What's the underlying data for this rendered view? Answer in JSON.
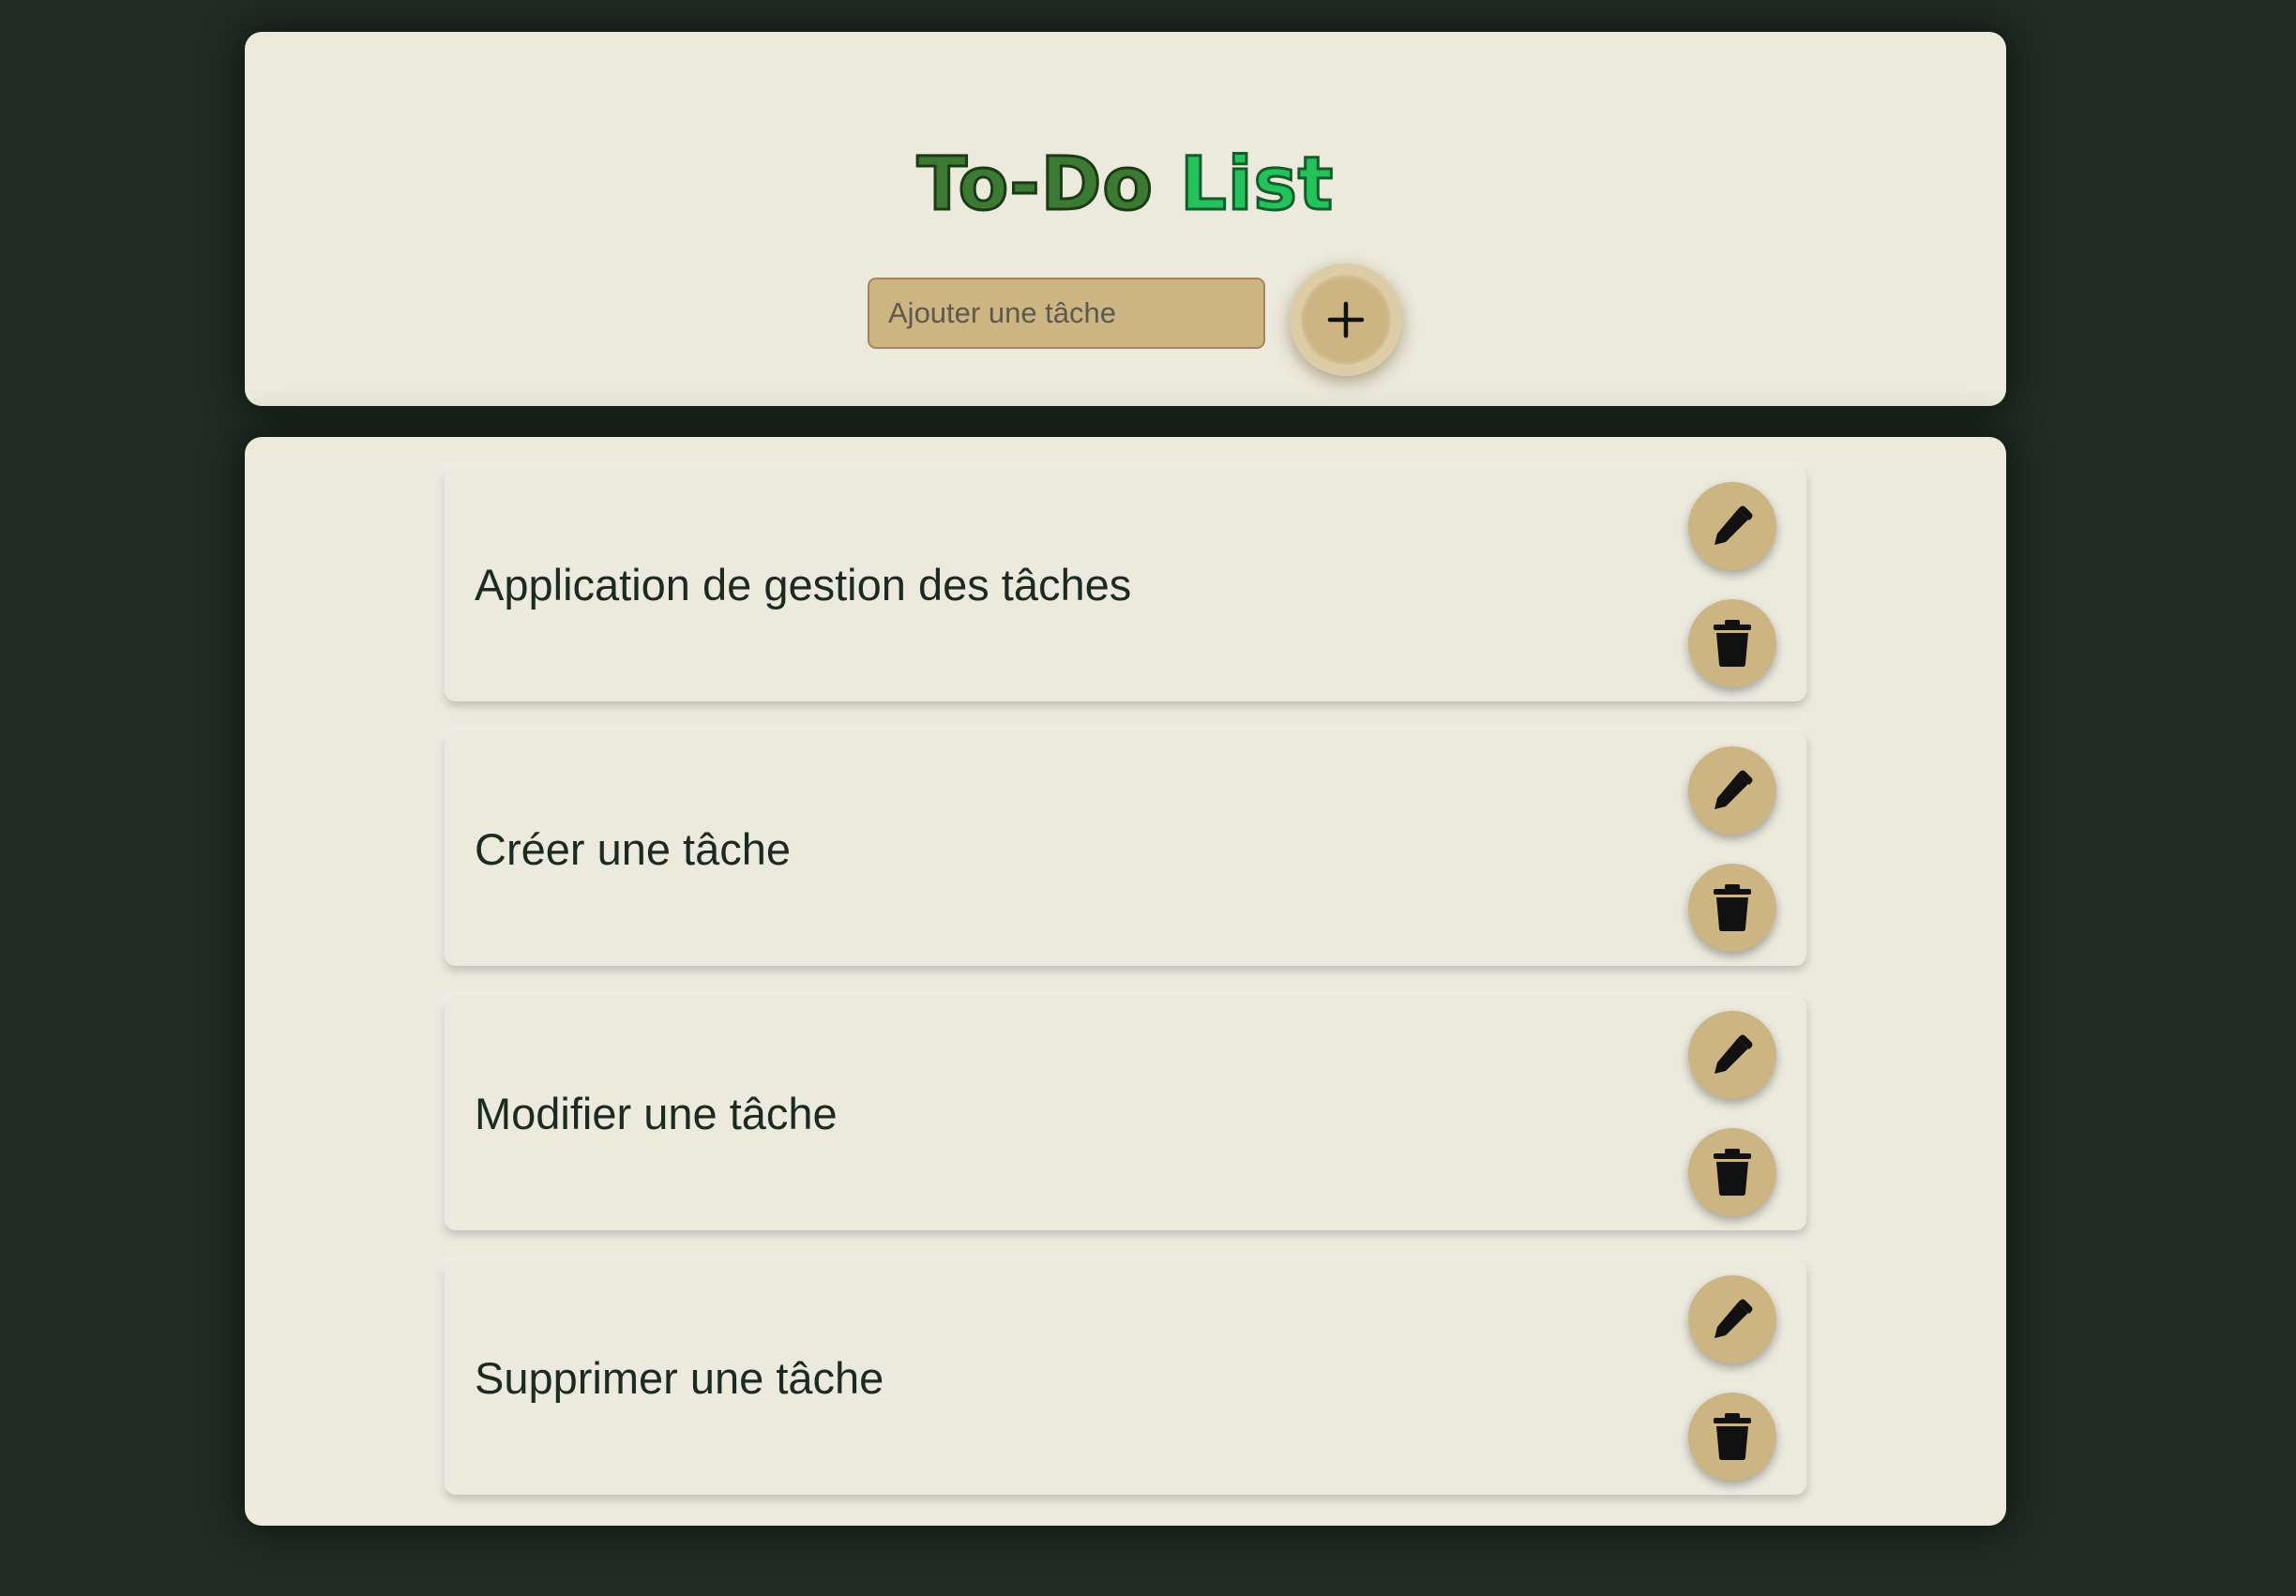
{
  "header": {
    "title_part1": "To-Do",
    "title_part2": "List"
  },
  "add_form": {
    "placeholder": "Ajouter une tâche",
    "value": "",
    "add_icon": "plus-icon"
  },
  "tasks": [
    {
      "text": "Application de gestion des tâches",
      "edit_icon": "pencil-icon",
      "delete_icon": "trash-icon"
    },
    {
      "text": "Créer une tâche",
      "edit_icon": "pencil-icon",
      "delete_icon": "trash-icon"
    },
    {
      "text": "Modifier une tâche",
      "edit_icon": "pencil-icon",
      "delete_icon": "trash-icon"
    },
    {
      "text": "Supprimer une tâche",
      "edit_icon": "pencil-icon",
      "delete_icon": "trash-icon"
    }
  ],
  "colors": {
    "background": "#1f2d24",
    "card": "#eceadd",
    "accent": "#ccb583",
    "title_dark_green": "#3c7a33",
    "title_bright_green": "#23c25a",
    "text": "#1c2b21"
  }
}
